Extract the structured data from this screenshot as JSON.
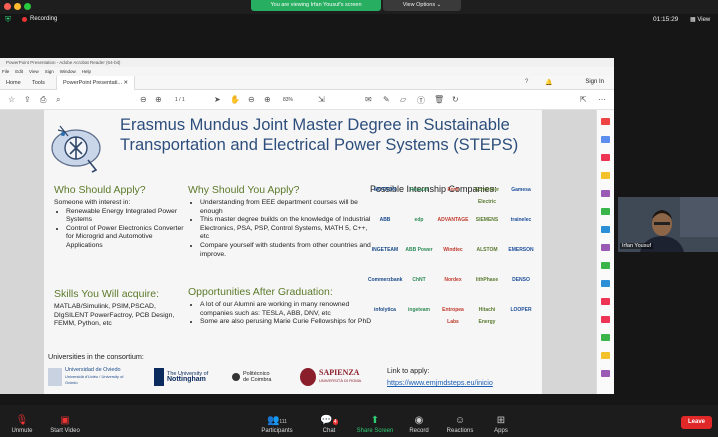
{
  "zoom": {
    "recording_label": "Recording",
    "viewing_banner": "You are viewing Irfan Yousuf's screen",
    "view_options": "View Options ⌄",
    "timer": "01:15:29",
    "view_label": "View",
    "participant_name": "Irfan Yousuf",
    "participants_count": "111",
    "chat_badge": "4",
    "toolbar": {
      "unmute": "Unmute",
      "start_video": "Start Video",
      "participants": "Participants",
      "chat": "Chat",
      "share_screen": "Share Screen",
      "record": "Record",
      "reactions": "Reactions",
      "apps": "Apps",
      "leave": "Leave"
    }
  },
  "acrobat": {
    "window_title": "PowerPoint Presentation - Adobe Acrobat Reader (64-bit)",
    "menu": [
      "File",
      "Edit",
      "View",
      "Sign",
      "Window",
      "Help"
    ],
    "tabs": [
      "Home",
      "Tools",
      "PowerPoint Presentati..."
    ],
    "sign_in": "Sign In",
    "page_current": "1",
    "page_total": "/ 1",
    "zoom_level": "83%"
  },
  "slide": {
    "title": "Erasmus Mundus Joint Master Degree in Sustainable Transportation and Electrical Power Systems  (STEPS)",
    "who": {
      "heading": "Who Should Apply?",
      "intro": "Someone with interest in:",
      "items": [
        "Renewable Energy Integrated Power Systems",
        "Control of Power Electronics Converter for Microgrid and Automotive Applications"
      ]
    },
    "why": {
      "heading": "Why Should You Apply?",
      "items": [
        "Understanding from EEE department courses will be enough",
        "This master degree builds on the knowledge of Industrial Electronics, PSA, PSP, Control Systems, MATH 5, C++, etc",
        "Compare yourself with students from other countries and improve."
      ]
    },
    "skills": {
      "heading": "Skills You Will acquire:",
      "text": "MATLAB/Simulink, PSIM,PSCAD, DIgSILENT PowerFactroy, PCB Design, FEMM, Python, etc"
    },
    "opportunities": {
      "heading": "Opportunities After Graduation:",
      "items": [
        "A lot of our Alumni are working in many renowned companies such as: TESLA, ABB, DNV, etc",
        "Some are also perusing Marie Curie Fellowships for PhD"
      ]
    },
    "internship_heading": "Possible Internship Companies:",
    "companies": [
      "MOTRON",
      "Renault",
      "Ford",
      "Schneider Electric",
      "Gamesa",
      "ABB",
      "edp",
      "ADVANTAGE",
      "SIEMENS",
      "trainelec",
      "INGETEAM",
      "ABB Power",
      "Windtec",
      "ALSTOM",
      "EMERSON",
      "Commerzbank",
      "ChNT",
      "Nordex",
      "lithPhase",
      "DENSO",
      "infolytica",
      "ingeteam",
      "Entropea Labs",
      "Hitachi Energy",
      "LOOPER"
    ],
    "consortium_label": "Universities in the consortium:",
    "universities": [
      {
        "name": "Universidad de Oviedo",
        "sub": "Universidá d'Uviéu / University of Oviedo"
      },
      {
        "name": "The University of",
        "sub": "Nottingham"
      },
      {
        "name": "Politécnico",
        "sub": "de Coimbra"
      },
      {
        "name": "SAPIENZA",
        "sub": "UNIVERSITÀ DI ROMA"
      }
    ],
    "link_label": "Link to apply:",
    "link_url": "https://www.emjmdsteps.eu/inicio"
  },
  "colors": {
    "title_blue": "#2d4e7c",
    "heading_green": "#5c7a2a",
    "zoom_green": "#27ae60",
    "leave_red": "#e02828"
  }
}
